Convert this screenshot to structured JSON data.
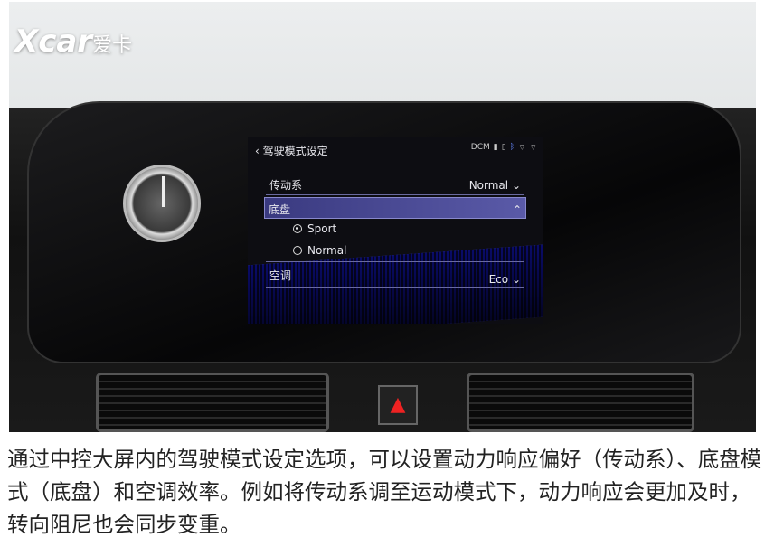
{
  "watermark": {
    "latin": "Xcar",
    "chinese": "爱卡"
  },
  "screen": {
    "title": "驾驶模式设定",
    "back_icon": "chevron-left-icon",
    "status_icons": [
      "dcm-icon",
      "signal-icon",
      "battery-icon",
      "bluetooth-icon",
      "wifi-icon",
      "wifi-icon"
    ],
    "status_text": "DCM",
    "rows": [
      {
        "label": "传动系",
        "value": "Normal"
      },
      {
        "label": "底盘",
        "expanded": true
      },
      {
        "option": "Sport",
        "selected": true
      },
      {
        "option": "Normal",
        "selected": false
      },
      {
        "label": "空调",
        "value": "Eco"
      }
    ]
  },
  "caption": "通过中控大屏内的驾驶模式设定选项，可以设置动力响应偏好（传动系）、底盘模式（底盘）和空调效率。例如将传动系调至运动模式下，动力响应会更加及时，转向阻尼也会同步变重。"
}
